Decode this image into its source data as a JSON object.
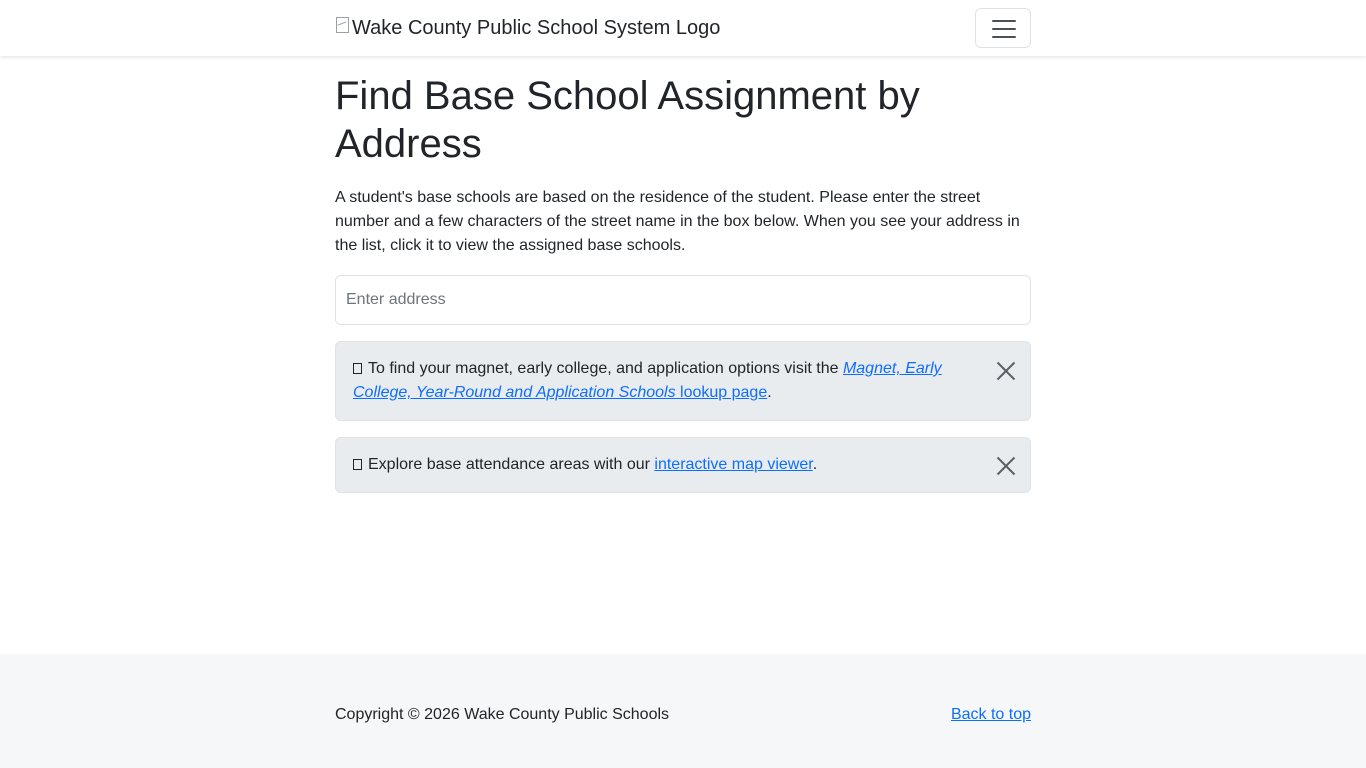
{
  "header": {
    "logo_alt": "Wake County Public School System Logo",
    "menu_toggle_label": "Toggle navigation"
  },
  "main": {
    "title": "Find Base School Assignment by Address",
    "description": "A student's base schools are based on the residence of the student. Please enter the street number and a few characters of the street name in the box below. When you see your address in the list, click it to view the assigned base schools.",
    "address_input": {
      "placeholder": "Enter address",
      "value": ""
    },
    "alerts": [
      {
        "icon": "info-glyph",
        "text_before": "To find your magnet, early college, and application options visit the ",
        "link_italic": "Magnet, Early College, Year-Round and Application Schools",
        "link_plain": " lookup page",
        "text_after": "."
      },
      {
        "icon": "info-glyph",
        "text_before": "Explore base attendance areas with our ",
        "link": "interactive map viewer",
        "text_after": "."
      }
    ]
  },
  "footer": {
    "copyright": "Copyright © 2026 Wake County Public Schools",
    "back_to_top": "Back to top"
  },
  "colors": {
    "link": "#0d6efd",
    "alert_bg": "#e9ecef",
    "footer_bg": "#f5f7f9",
    "text": "#212529"
  }
}
